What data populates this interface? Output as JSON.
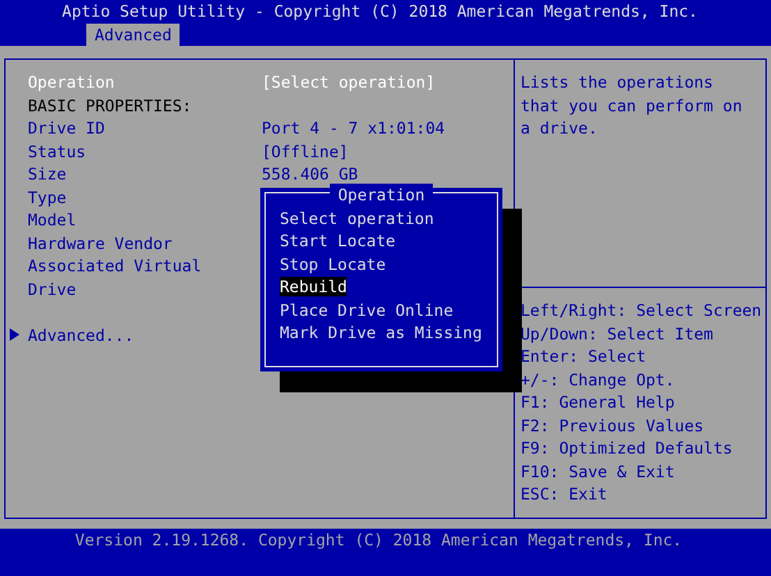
{
  "window": {
    "title": "Aptio Setup Utility - Copyright (C) 2018 American Megatrends, Inc."
  },
  "tabs": [
    {
      "label": "Advanced",
      "selected": true
    }
  ],
  "items": [
    {
      "kind": "option",
      "label": "Operation",
      "value": "[Select operation]",
      "selected": true
    },
    {
      "kind": "heading",
      "label": "BASIC PROPERTIES:"
    },
    {
      "kind": "info",
      "label": "Drive ID",
      "value": "Port 4 - 7 x1:01:04"
    },
    {
      "kind": "info",
      "label": "Status",
      "value": "[Offline]"
    },
    {
      "kind": "info",
      "label": "Size",
      "value": "558.406 GB"
    },
    {
      "kind": "info",
      "label": "Type"
    },
    {
      "kind": "info",
      "label": "Model"
    },
    {
      "kind": "info",
      "label": "Hardware Vendor"
    },
    {
      "kind": "info",
      "label": "Associated Virtual Drive"
    },
    {
      "kind": "spacer"
    },
    {
      "kind": "submenu",
      "label": "Advanced...",
      "selected": false
    }
  ],
  "popup": {
    "title": "Operation",
    "options": [
      {
        "label": "Select operation",
        "selected": false
      },
      {
        "label": "Start Locate",
        "selected": false
      },
      {
        "label": "Stop Locate",
        "selected": false
      },
      {
        "label": "Rebuild",
        "selected": true
      },
      {
        "label": "Place Drive Online",
        "selected": false
      },
      {
        "label": "Mark Drive as Missing",
        "selected": false
      }
    ]
  },
  "help": "Lists the operations that you can perform on a drive.",
  "keys": [
    "Left/Right: Select Screen",
    "Up/Down: Select Item",
    "Enter: Select",
    "+/-: Change Opt.",
    "F1: General Help",
    "F2: Previous Values",
    "F9: Optimized Defaults",
    "F10: Save & Exit",
    "ESC: Exit"
  ],
  "footer": "Version 2.19.1268. Copyright (C) 2018 American Megatrends, Inc."
}
